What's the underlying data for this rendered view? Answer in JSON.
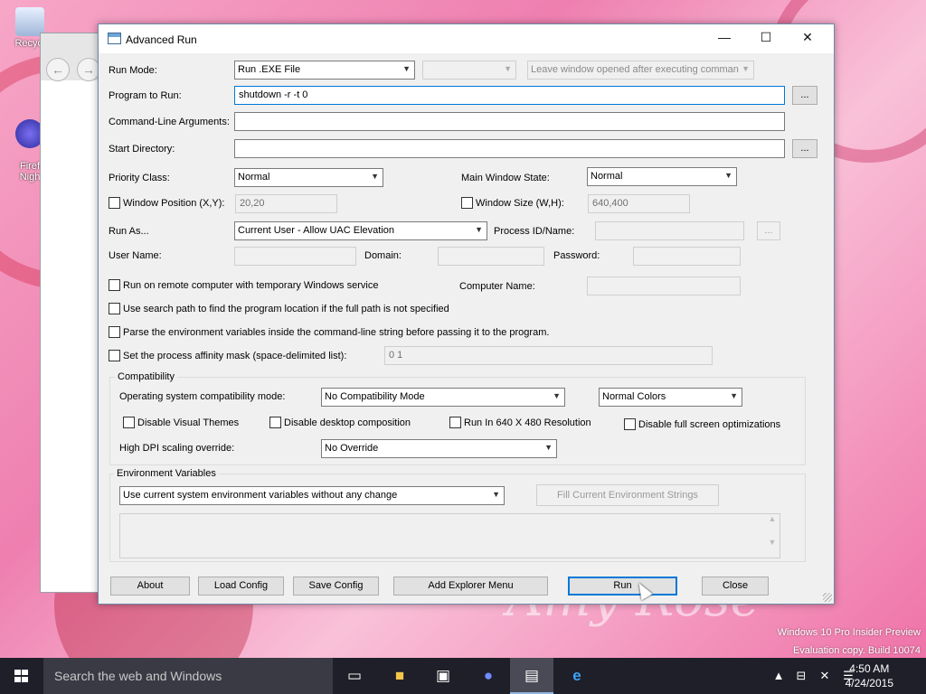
{
  "desktop": {
    "icons": [
      {
        "label": "Recycl",
        "icon": "recycle-bin-icon"
      },
      {
        "label": "Firef\nNigh",
        "icon": "firefox-nightly-icon"
      }
    ],
    "watermark": {
      "line1": "Windows 10 Pro Insider Preview",
      "line2": "Evaluation copy. Build 10074"
    },
    "wallpaper_text": "Amy Rose"
  },
  "window": {
    "title": "Advanced Run",
    "controls": {
      "minimize": "—",
      "maximize": "☐",
      "close": "✕"
    }
  },
  "form": {
    "run_mode": {
      "label": "Run Mode:",
      "value": "Run .EXE File",
      "aux_value": "",
      "leave_window": "Leave window opened after executing comman"
    },
    "program": {
      "label": "Program to Run:",
      "value": "shutdown -r -t 0",
      "browse": "..."
    },
    "args": {
      "label": "Command-Line Arguments:",
      "value": ""
    },
    "start_dir": {
      "label": "Start Directory:",
      "value": "",
      "browse": "..."
    },
    "priority": {
      "label": "Priority Class:",
      "value": "Normal"
    },
    "main_window_state": {
      "label": "Main Window State:",
      "value": "Normal"
    },
    "window_position": {
      "label": "Window Position (X,Y):",
      "value": "20,20"
    },
    "window_size": {
      "label": "Window Size (W,H):",
      "value": "640,400"
    },
    "run_as": {
      "label": "Run As...",
      "value": "Current User - Allow UAC Elevation"
    },
    "process_id": {
      "label": "Process ID/Name:",
      "value": "",
      "browse": "..."
    },
    "user_name": {
      "label": "User Name:",
      "value": ""
    },
    "domain": {
      "label": "Domain:",
      "value": ""
    },
    "password": {
      "label": "Password:",
      "value": ""
    },
    "remote": {
      "label": "Run on remote computer with temporary Windows service"
    },
    "computer_name": {
      "label": "Computer Name:",
      "value": ""
    },
    "search_path": {
      "label": "Use search path to find the program location if the full path is not specified"
    },
    "parse_env": {
      "label": "Parse the environment variables inside the command-line string before passing it to the program."
    },
    "affinity": {
      "label": "Set the process affinity mask (space-delimited list):",
      "value": "0 1"
    }
  },
  "compatibility": {
    "title": "Compatibility",
    "os_mode": {
      "label": "Operating system compatibility mode:",
      "value": "No Compatibility Mode"
    },
    "colors": {
      "value": "Normal Colors"
    },
    "disable_visual_themes": "Disable Visual Themes",
    "disable_desktop_composition": "Disable desktop composition",
    "run_640": "Run In 640 X 480 Resolution",
    "disable_fullscreen_opt": "Disable full screen optimizations",
    "dpi": {
      "label": "High DPI scaling override:",
      "value": "No Override"
    }
  },
  "environment": {
    "title": "Environment Variables",
    "mode": "Use current system environment variables without any change",
    "fill_button": "Fill Current Environment Strings"
  },
  "buttons": {
    "about": "About",
    "load_config": "Load Config",
    "save_config": "Save Config",
    "add_explorer_menu": "Add Explorer Menu",
    "run": "Run",
    "close": "Close"
  },
  "taskbar": {
    "search_placeholder": "Search the web and Windows",
    "clock_time": "4:50 AM",
    "clock_date": "4/24/2015"
  }
}
